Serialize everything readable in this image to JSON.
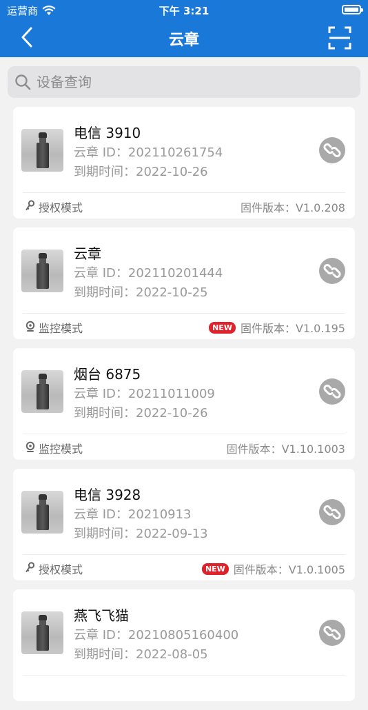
{
  "status_bar": {
    "carrier": "运营商",
    "time": "下午 3:21"
  },
  "header": {
    "title": "云章"
  },
  "search": {
    "placeholder": "设备查询"
  },
  "devices": [
    {
      "name": "电信 3910",
      "id_line": "云章 ID：202110261754",
      "expire_line": "到期时间：2022-10-26",
      "mode": "授权模式",
      "mode_icon": "key-icon",
      "firmware": "固件版本：V1.0.208",
      "new": false
    },
    {
      "name": "云章",
      "id_line": "云章 ID：202110201444",
      "expire_line": "到期时间：2022-10-25",
      "mode": "监控模式",
      "mode_icon": "camera-icon",
      "firmware": "固件版本：V1.0.195",
      "new": true,
      "new_label": "NEW"
    },
    {
      "name": "烟台 6875",
      "id_line": "云章 ID：20211011009",
      "expire_line": "到期时间：2022-10-26",
      "mode": "监控模式",
      "mode_icon": "camera-icon",
      "firmware": "固件版本：V1.10.1003",
      "new": false
    },
    {
      "name": "电信 3928",
      "id_line": "云章 ID：20210913",
      "expire_line": "到期时间：2022-09-13",
      "mode": "授权模式",
      "mode_icon": "key-icon",
      "firmware": "固件版本：V1.0.1005",
      "new": true,
      "new_label": "NEW"
    },
    {
      "name": "燕飞飞猫",
      "id_line": "云章 ID：20210805160400",
      "expire_line": "到期时间：2022-08-05",
      "mode": "",
      "mode_icon": "",
      "firmware": "",
      "new": false
    }
  ],
  "colors": {
    "primary": "#1a78d8",
    "badge": "#e0222a",
    "link_button": "#a9a9a9"
  }
}
